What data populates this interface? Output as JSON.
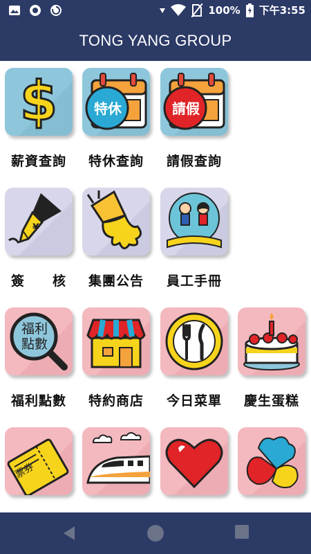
{
  "status_bar": {
    "battery": "100%",
    "time": "下午3:55",
    "icons": [
      "image-icon",
      "record-icon",
      "sync-icon",
      "signal-arrow-icon",
      "wifi-icon",
      "no-sim-icon",
      "battery-charging-icon"
    ]
  },
  "app_bar": {
    "title": "TONG YANG GROUP"
  },
  "tiles": [
    {
      "label": "薪資查詢",
      "icon": "dollar-icon"
    },
    {
      "label": "特休查詢",
      "icon": "calendar-special-leave-icon",
      "badge": "特休"
    },
    {
      "label": "請假查詢",
      "icon": "calendar-leave-request-icon",
      "badge": "請假"
    },
    {
      "label": "簽　　核",
      "icon": "pen-nib-icon"
    },
    {
      "label": "集團公告",
      "icon": "megaphone-icon"
    },
    {
      "label": "員工手冊",
      "icon": "book-children-icon"
    },
    {
      "label": "福利點數",
      "icon": "magnifier-points-icon",
      "badge": "福利點數"
    },
    {
      "label": "特約商店",
      "icon": "store-icon"
    },
    {
      "label": "今日菜單",
      "icon": "plate-cutlery-icon"
    },
    {
      "label": "慶生蛋糕",
      "icon": "birthday-cake-icon"
    },
    {
      "label": "",
      "icon": "ticket-icon",
      "badge": "票券"
    },
    {
      "label": "",
      "icon": "bullet-train-icon"
    },
    {
      "label": "",
      "icon": "heart-icon"
    },
    {
      "label": "",
      "icon": "helping-hands-icon"
    }
  ],
  "nav_bar": {
    "icons": [
      "back-icon",
      "home-icon",
      "recents-icon"
    ]
  },
  "colors": {
    "primary": "#2c3a66",
    "tile_blue": "#8ec7dc",
    "tile_lilac": "#d7d6ea",
    "tile_pink": "#f4b8bf"
  }
}
